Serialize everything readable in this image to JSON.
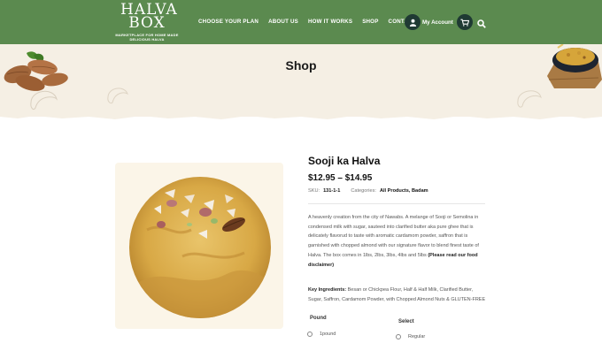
{
  "logo": {
    "main": "HALVA BOX",
    "tagline_1": "MARKETPLACE FOR HOME MADE",
    "tagline_2": "DELICIOUS HALVA"
  },
  "nav": {
    "items": [
      "CHOOSE YOUR PLAN",
      "ABOUT US",
      "HOW IT WORKS",
      "SHOP",
      "CONTACT"
    ],
    "account_label": "My Account",
    "icons": [
      "user-icon",
      "cart-icon",
      "search-icon"
    ]
  },
  "banner": {
    "title": "Shop"
  },
  "product": {
    "title": "Sooji ka Halva",
    "price": "$12.95 – $14.95",
    "sku_label": "SKU:",
    "sku": "131-1-1",
    "categories_label": "Categories:",
    "categories": "All Products, Badam",
    "description": "A heavenly creation from the city of Nawabs. A melange of Sooji or Semolina in condensed milk with sugar, sauteed into clarified butter aka pure ghee that is delicately flavorud to taste with aromatic cardamom powder, saffron that is garnished with chopped almond with our signature flavor to blend finest taste of Halva. The box comes in 1lbs, 2lbs, 3lbs, 4lbs and 5lbs",
    "description_bold": "(Please read our food disclaimer)",
    "ingredients_label": "Key Ingredients:",
    "ingredients": "Besan or Chickpea Flour, Half & Half Milk, Clarified Butter, Sugar, Saffron, Cardamom Powder, with Chopped Almond Nuts & GLUTEN-FREE"
  },
  "options": {
    "pound_label": "Pound",
    "pound_first": "1pound",
    "select_label": "Select",
    "select_first": "Regular"
  },
  "colors": {
    "header_green": "#5b8a4f",
    "banner_cream": "#f5efe4",
    "dark_icon_bg": "#1f3a33"
  }
}
